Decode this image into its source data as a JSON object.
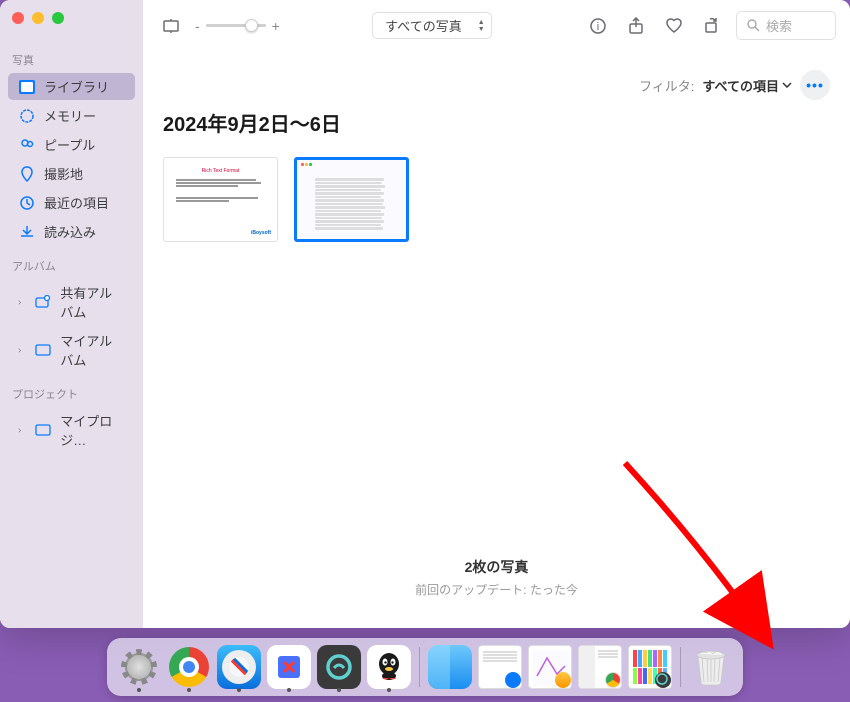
{
  "sidebar": {
    "sections": {
      "photos_label": "写真",
      "albums_label": "アルバム",
      "projects_label": "プロジェクト"
    },
    "items": {
      "library": "ライブラリ",
      "memories": "メモリー",
      "people": "ピープル",
      "places": "撮影地",
      "recent": "最近の項目",
      "import": "読み込み",
      "shared_albums": "共有アルバム",
      "my_albums": "マイアルバム",
      "my_projects": "マイプロジ…"
    }
  },
  "toolbar": {
    "view_dropdown": "すべての写真",
    "search_placeholder": "検索"
  },
  "filters": {
    "label": "フィルタ:",
    "value": "すべての項目"
  },
  "content": {
    "date_title": "2024年9月2日〜6日"
  },
  "footer": {
    "count": "2枚の写真",
    "updated": "前回のアップデート: たった今"
  }
}
